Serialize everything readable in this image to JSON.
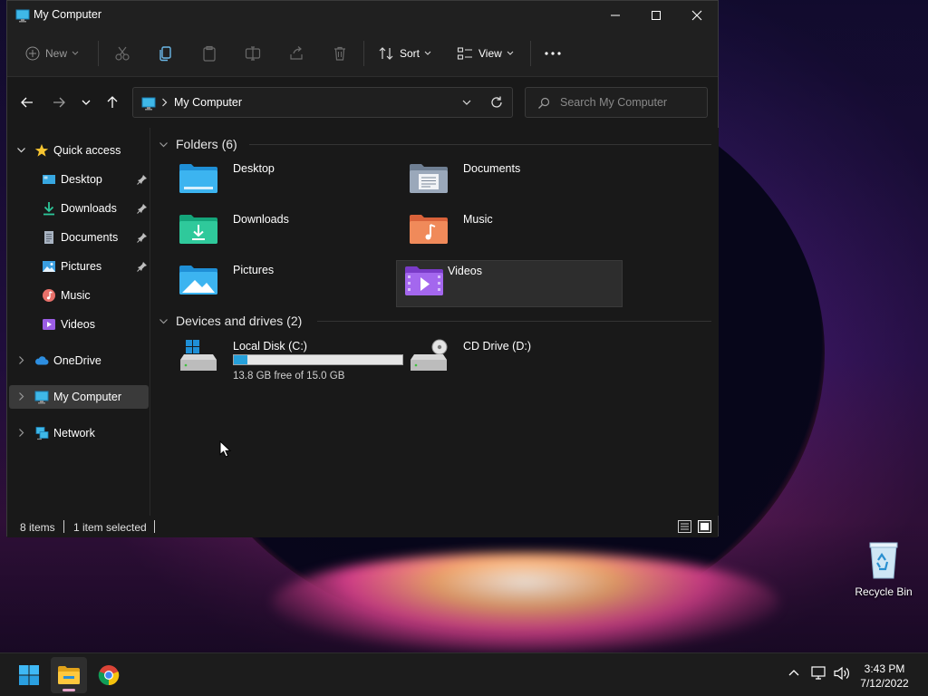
{
  "window": {
    "title": "My Computer",
    "controls": {
      "minimize": "minimize",
      "maximize": "maximize",
      "close": "close"
    }
  },
  "toolbar": {
    "new_label": "New",
    "sort_label": "Sort",
    "view_label": "View"
  },
  "address": {
    "path": "My Computer",
    "search_placeholder": "Search My Computer"
  },
  "sidebar": {
    "quick_access": "Quick access",
    "items": [
      {
        "label": "Desktop",
        "pinned": true
      },
      {
        "label": "Downloads",
        "pinned": true
      },
      {
        "label": "Documents",
        "pinned": true
      },
      {
        "label": "Pictures",
        "pinned": true
      },
      {
        "label": "Music",
        "pinned": false
      },
      {
        "label": "Videos",
        "pinned": false
      }
    ],
    "onedrive": "OneDrive",
    "my_computer": "My Computer",
    "network": "Network"
  },
  "content": {
    "folders_header": "Folders (6)",
    "folders": [
      {
        "label": "Desktop",
        "icon": "desktop-folder-icon"
      },
      {
        "label": "Documents",
        "icon": "documents-folder-icon"
      },
      {
        "label": "Downloads",
        "icon": "downloads-folder-icon"
      },
      {
        "label": "Music",
        "icon": "music-folder-icon"
      },
      {
        "label": "Pictures",
        "icon": "pictures-folder-icon"
      },
      {
        "label": "Videos",
        "icon": "videos-folder-icon",
        "selected": true
      }
    ],
    "drives_header": "Devices and drives (2)",
    "drives": [
      {
        "label": "Local Disk (C:)",
        "free_text": "13.8 GB free of 15.0 GB",
        "used_fraction": 0.08
      },
      {
        "label": "CD Drive (D:)"
      }
    ]
  },
  "status": {
    "items_count": "8 items",
    "selection": "1 item selected"
  },
  "desktop": {
    "recycle_bin": "Recycle Bin"
  },
  "taskbar": {
    "time": "3:43 PM",
    "date": "7/12/2022"
  },
  "colors": {
    "accent": "#26a0da",
    "window_bg": "#191919",
    "taskbar_bg": "#1c1c1c"
  }
}
